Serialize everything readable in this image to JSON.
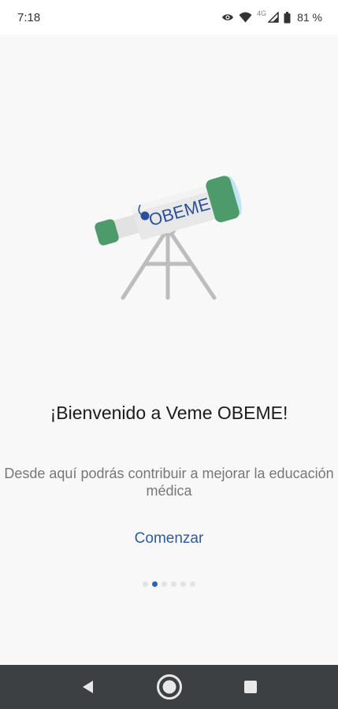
{
  "status_bar": {
    "time": "7:18",
    "network": "4G",
    "battery": "81 %",
    "icons": [
      "eye-icon",
      "wifi-icon",
      "signal-icon",
      "battery-icon"
    ]
  },
  "illustration": {
    "icon": "telescope-icon",
    "logo_text": "OBEME",
    "colors": {
      "green": "#4d9a6a",
      "tube": "#e6e6e6",
      "lens": "#bfe6f2",
      "logo_blue": "#2b4fa0",
      "stand": "#bdbdbd"
    }
  },
  "onboarding": {
    "title": "¡Bienvenido a Veme OBEME!",
    "subtitle": "Desde aquí podrás contribuir a mejorar la educación médica",
    "start_label": "Comenzar",
    "page_count": 6,
    "active_page": 2
  },
  "colors": {
    "accent": "#2b5aa7",
    "active_dot": "#2b63b8",
    "nav_bar": "#3c4043"
  },
  "nav_bar": {
    "icons": [
      "back-icon",
      "home-icon",
      "recents-icon"
    ]
  }
}
